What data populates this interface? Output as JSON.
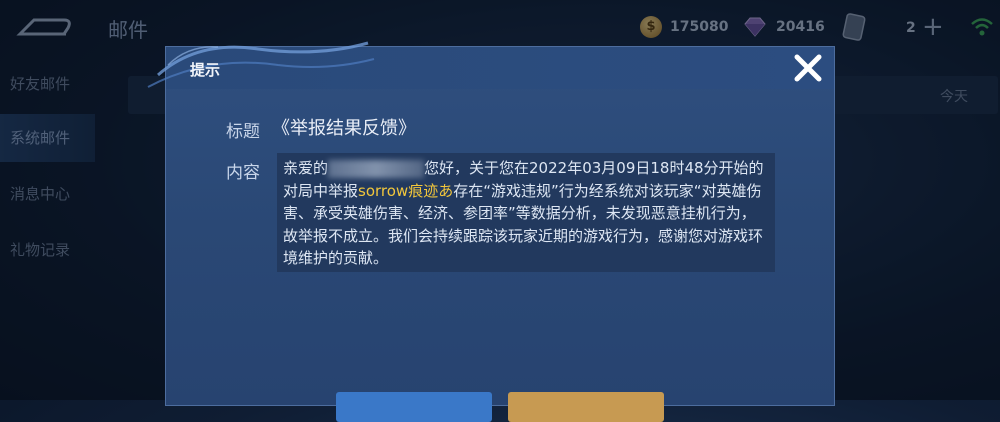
{
  "header": {
    "title": "邮件",
    "coins": "175080",
    "gems": "20416",
    "tickets": "2"
  },
  "sidebar": {
    "items": [
      {
        "label": "好友邮件"
      },
      {
        "label": "系统邮件"
      },
      {
        "label": "消息中心"
      },
      {
        "label": "礼物记录"
      }
    ]
  },
  "list": {
    "date": "今天"
  },
  "dialog": {
    "title": "提示",
    "subject_label": "标题",
    "subject_value": "《举报结果反馈》",
    "content_label": "内容",
    "content_prefix": "亲爱的",
    "content_part1": "您好，关于您在2022年03月09日18时48分开始的对局中举报",
    "content_highlight": "sorrow痕迹あ",
    "content_part2": "存在“游戏违规”行为经系统对该玩家“对英雄伤害、承受英雄伤害、经济、参团率”等数据分析，未发现恶意挂机行为，故举报不成立。我们会持续跟踪该玩家近期的游戏行为，感谢您对游戏环境维护的贡献。"
  },
  "colors": {
    "highlight": "#f1c63c",
    "dialog_bg": "#2f4f7f",
    "accent_blue": "#3a78c8",
    "accent_gold": "#c79a52"
  }
}
